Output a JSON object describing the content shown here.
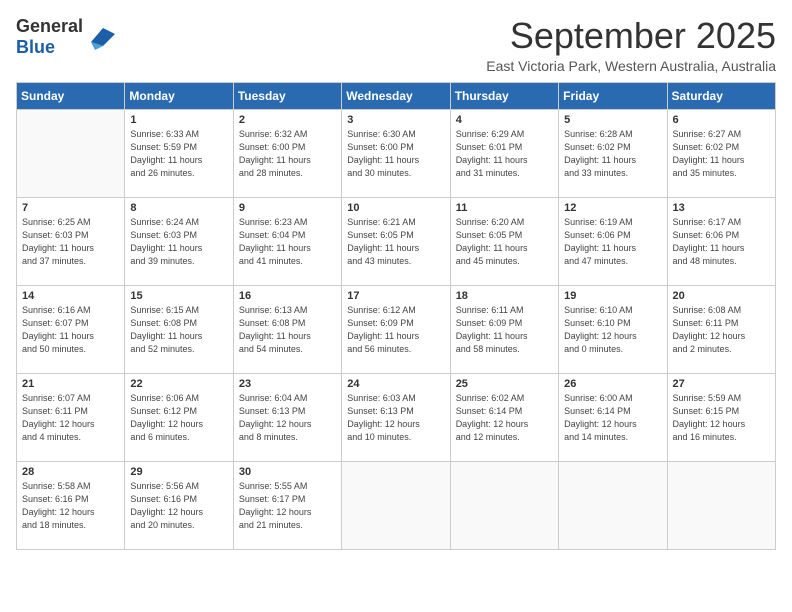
{
  "header": {
    "logo_general": "General",
    "logo_blue": "Blue",
    "title": "September 2025",
    "location": "East Victoria Park, Western Australia, Australia"
  },
  "weekdays": [
    "Sunday",
    "Monday",
    "Tuesday",
    "Wednesday",
    "Thursday",
    "Friday",
    "Saturday"
  ],
  "weeks": [
    [
      {
        "day": "",
        "info": ""
      },
      {
        "day": "1",
        "info": "Sunrise: 6:33 AM\nSunset: 5:59 PM\nDaylight: 11 hours\nand 26 minutes."
      },
      {
        "day": "2",
        "info": "Sunrise: 6:32 AM\nSunset: 6:00 PM\nDaylight: 11 hours\nand 28 minutes."
      },
      {
        "day": "3",
        "info": "Sunrise: 6:30 AM\nSunset: 6:00 PM\nDaylight: 11 hours\nand 30 minutes."
      },
      {
        "day": "4",
        "info": "Sunrise: 6:29 AM\nSunset: 6:01 PM\nDaylight: 11 hours\nand 31 minutes."
      },
      {
        "day": "5",
        "info": "Sunrise: 6:28 AM\nSunset: 6:02 PM\nDaylight: 11 hours\nand 33 minutes."
      },
      {
        "day": "6",
        "info": "Sunrise: 6:27 AM\nSunset: 6:02 PM\nDaylight: 11 hours\nand 35 minutes."
      }
    ],
    [
      {
        "day": "7",
        "info": "Sunrise: 6:25 AM\nSunset: 6:03 PM\nDaylight: 11 hours\nand 37 minutes."
      },
      {
        "day": "8",
        "info": "Sunrise: 6:24 AM\nSunset: 6:03 PM\nDaylight: 11 hours\nand 39 minutes."
      },
      {
        "day": "9",
        "info": "Sunrise: 6:23 AM\nSunset: 6:04 PM\nDaylight: 11 hours\nand 41 minutes."
      },
      {
        "day": "10",
        "info": "Sunrise: 6:21 AM\nSunset: 6:05 PM\nDaylight: 11 hours\nand 43 minutes."
      },
      {
        "day": "11",
        "info": "Sunrise: 6:20 AM\nSunset: 6:05 PM\nDaylight: 11 hours\nand 45 minutes."
      },
      {
        "day": "12",
        "info": "Sunrise: 6:19 AM\nSunset: 6:06 PM\nDaylight: 11 hours\nand 47 minutes."
      },
      {
        "day": "13",
        "info": "Sunrise: 6:17 AM\nSunset: 6:06 PM\nDaylight: 11 hours\nand 48 minutes."
      }
    ],
    [
      {
        "day": "14",
        "info": "Sunrise: 6:16 AM\nSunset: 6:07 PM\nDaylight: 11 hours\nand 50 minutes."
      },
      {
        "day": "15",
        "info": "Sunrise: 6:15 AM\nSunset: 6:08 PM\nDaylight: 11 hours\nand 52 minutes."
      },
      {
        "day": "16",
        "info": "Sunrise: 6:13 AM\nSunset: 6:08 PM\nDaylight: 11 hours\nand 54 minutes."
      },
      {
        "day": "17",
        "info": "Sunrise: 6:12 AM\nSunset: 6:09 PM\nDaylight: 11 hours\nand 56 minutes."
      },
      {
        "day": "18",
        "info": "Sunrise: 6:11 AM\nSunset: 6:09 PM\nDaylight: 11 hours\nand 58 minutes."
      },
      {
        "day": "19",
        "info": "Sunrise: 6:10 AM\nSunset: 6:10 PM\nDaylight: 12 hours\nand 0 minutes."
      },
      {
        "day": "20",
        "info": "Sunrise: 6:08 AM\nSunset: 6:11 PM\nDaylight: 12 hours\nand 2 minutes."
      }
    ],
    [
      {
        "day": "21",
        "info": "Sunrise: 6:07 AM\nSunset: 6:11 PM\nDaylight: 12 hours\nand 4 minutes."
      },
      {
        "day": "22",
        "info": "Sunrise: 6:06 AM\nSunset: 6:12 PM\nDaylight: 12 hours\nand 6 minutes."
      },
      {
        "day": "23",
        "info": "Sunrise: 6:04 AM\nSunset: 6:13 PM\nDaylight: 12 hours\nand 8 minutes."
      },
      {
        "day": "24",
        "info": "Sunrise: 6:03 AM\nSunset: 6:13 PM\nDaylight: 12 hours\nand 10 minutes."
      },
      {
        "day": "25",
        "info": "Sunrise: 6:02 AM\nSunset: 6:14 PM\nDaylight: 12 hours\nand 12 minutes."
      },
      {
        "day": "26",
        "info": "Sunrise: 6:00 AM\nSunset: 6:14 PM\nDaylight: 12 hours\nand 14 minutes."
      },
      {
        "day": "27",
        "info": "Sunrise: 5:59 AM\nSunset: 6:15 PM\nDaylight: 12 hours\nand 16 minutes."
      }
    ],
    [
      {
        "day": "28",
        "info": "Sunrise: 5:58 AM\nSunset: 6:16 PM\nDaylight: 12 hours\nand 18 minutes."
      },
      {
        "day": "29",
        "info": "Sunrise: 5:56 AM\nSunset: 6:16 PM\nDaylight: 12 hours\nand 20 minutes."
      },
      {
        "day": "30",
        "info": "Sunrise: 5:55 AM\nSunset: 6:17 PM\nDaylight: 12 hours\nand 21 minutes."
      },
      {
        "day": "",
        "info": ""
      },
      {
        "day": "",
        "info": ""
      },
      {
        "day": "",
        "info": ""
      },
      {
        "day": "",
        "info": ""
      }
    ]
  ]
}
